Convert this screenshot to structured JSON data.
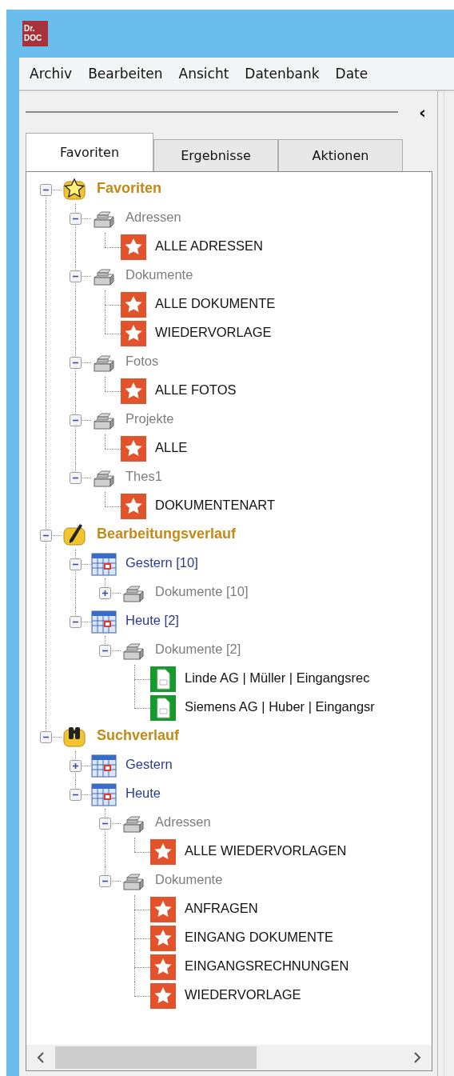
{
  "app_logo": {
    "lines": [
      "Dr.",
      "DOC"
    ]
  },
  "menu": [
    "Archiv",
    "Bearbeiten",
    "Ansicht",
    "Datenbank",
    "Date"
  ],
  "panel": {
    "collapse_glyph": "‹"
  },
  "tabs": [
    {
      "label": "Favoriten",
      "selected": true
    },
    {
      "label": "Ergebnisse",
      "selected": false
    },
    {
      "label": "Aktionen",
      "selected": false
    }
  ],
  "tree": [
    {
      "label": "Favoriten",
      "kind": "favorites",
      "expanded": true,
      "children": [
        {
          "label": "Adressen",
          "kind": "group",
          "expanded": true,
          "children": [
            {
              "label": "ALLE ADRESSEN",
              "kind": "favorite"
            }
          ]
        },
        {
          "label": "Dokumente",
          "kind": "group",
          "expanded": true,
          "children": [
            {
              "label": "ALLE DOKUMENTE",
              "kind": "favorite"
            },
            {
              "label": "WIEDERVORLAGE",
              "kind": "favorite"
            }
          ]
        },
        {
          "label": "Fotos",
          "kind": "group",
          "expanded": true,
          "children": [
            {
              "label": "ALLE FOTOS",
              "kind": "favorite"
            }
          ]
        },
        {
          "label": "Projekte",
          "kind": "group",
          "expanded": true,
          "children": [
            {
              "label": "ALLE",
              "kind": "favorite"
            }
          ]
        },
        {
          "label": "Thes1",
          "kind": "group",
          "expanded": true,
          "children": [
            {
              "label": "DOKUMENTENART",
              "kind": "favorite"
            }
          ]
        }
      ]
    },
    {
      "label": "Bearbeitungsverlauf",
      "kind": "history",
      "expanded": true,
      "children": [
        {
          "label": "Gestern [10]",
          "kind": "date",
          "expanded": true,
          "children": [
            {
              "label": "Dokumente [10]",
              "kind": "group",
              "expanded": false
            }
          ]
        },
        {
          "label": "Heute [2]",
          "kind": "date",
          "expanded": true,
          "children": [
            {
              "label": "Dokumente [2]",
              "kind": "group",
              "expanded": true,
              "children": [
                {
                  "label": "Linde AG | Müller | Eingangsrec",
                  "kind": "document"
                },
                {
                  "label": "Siemens AG | Huber | Eingangsr",
                  "kind": "document"
                }
              ]
            }
          ]
        }
      ]
    },
    {
      "label": "Suchverlauf",
      "kind": "search",
      "expanded": true,
      "children": [
        {
          "label": "Gestern",
          "kind": "date",
          "expanded": false
        },
        {
          "label": "Heute",
          "kind": "date",
          "expanded": true,
          "children": [
            {
              "label": "Adressen",
              "kind": "group",
              "expanded": true,
              "children": [
                {
                  "label": "ALLE WIEDERVORLAGEN",
                  "kind": "favorite"
                }
              ]
            },
            {
              "label": "Dokumente",
              "kind": "group",
              "expanded": true,
              "children": [
                {
                  "label": "ANFRAGEN",
                  "kind": "favorite"
                },
                {
                  "label": "EINGANG DOKUMENTE",
                  "kind": "favorite"
                },
                {
                  "label": "EINGANGSRECHNUNGEN",
                  "kind": "favorite"
                },
                {
                  "label": "WIEDERVORLAGE",
                  "kind": "favorite"
                }
              ]
            }
          ]
        }
      ]
    }
  ]
}
